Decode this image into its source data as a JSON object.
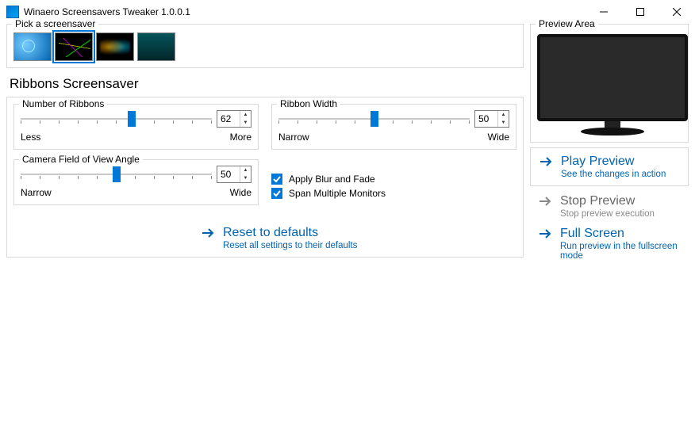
{
  "window": {
    "title": "Winaero Screensavers Tweaker 1.0.0.1"
  },
  "picker": {
    "legend": "Pick a screensaver",
    "selected_index": 1
  },
  "settings": {
    "heading": "Ribbons Screensaver",
    "num_ribbons": {
      "legend": "Number of Ribbons",
      "value": "62",
      "min_label": "Less",
      "max_label": "More",
      "position_pct": 58
    },
    "ribbon_width": {
      "legend": "Ribbon Width",
      "value": "50",
      "min_label": "Narrow",
      "max_label": "Wide",
      "position_pct": 50
    },
    "fov": {
      "legend": "Camera Field of View Angle",
      "value": "50",
      "min_label": "Narrow",
      "max_label": "Wide",
      "position_pct": 50
    },
    "checks": {
      "blur": {
        "label": "Apply Blur and Fade",
        "checked": true
      },
      "span": {
        "label": "Span Multiple Monitors",
        "checked": true
      }
    },
    "reset": {
      "label": "Reset to defaults",
      "sub": "Reset all settings to their defaults"
    }
  },
  "preview": {
    "legend": "Preview Area",
    "play": {
      "label": "Play Preview",
      "sub": "See the changes in action"
    },
    "stop": {
      "label": "Stop Preview",
      "sub": "Stop preview execution"
    },
    "full": {
      "label": "Full Screen",
      "sub": "Run preview in the fullscreen mode"
    }
  }
}
